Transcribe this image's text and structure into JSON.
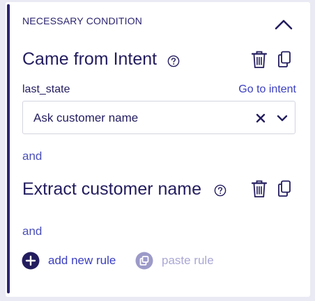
{
  "section": {
    "title": "NECESSARY CONDITION"
  },
  "rules": [
    {
      "title": "Came from Intent",
      "field_label": "last_state",
      "link_label": "Go to intent",
      "select_value": "Ask customer name"
    },
    {
      "title": "Extract customer name"
    }
  ],
  "connectors": [
    "and",
    "and"
  ],
  "actions": {
    "add_label": "add new rule",
    "paste_label": "paste rule"
  },
  "colors": {
    "accent": "#2b2470",
    "link": "#3a3ec0",
    "disabled": "#9c9ac8"
  },
  "icons": {
    "collapse": "chevron-up-icon",
    "help": "help-circle-icon",
    "delete": "trash-icon",
    "duplicate": "copy-icon",
    "clear": "close-icon",
    "dropdown": "chevron-down-icon",
    "add": "plus-circle-icon",
    "paste": "paste-icon"
  }
}
